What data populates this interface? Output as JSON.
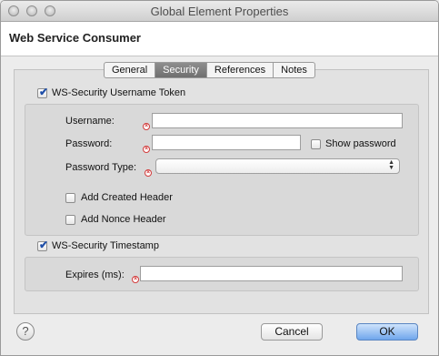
{
  "window": {
    "title": "Global Element Properties"
  },
  "header": {
    "title": "Web Service Consumer"
  },
  "tabs": [
    {
      "label": "General",
      "active": false
    },
    {
      "label": "Security",
      "active": true
    },
    {
      "label": "References",
      "active": false
    },
    {
      "label": "Notes",
      "active": false
    }
  ],
  "security": {
    "username_token": {
      "label": "WS-Security Username Token",
      "checked": true,
      "username_label": "Username:",
      "username_value": "",
      "password_label": "Password:",
      "password_value": "",
      "show_password_label": "Show password",
      "password_type_label": "Password Type:",
      "password_type_value": "",
      "add_created_header_label": "Add Created Header",
      "add_nonce_header_label": "Add Nonce Header"
    },
    "timestamp": {
      "label": "WS-Security Timestamp",
      "checked": true,
      "expires_label": "Expires (ms):",
      "expires_value": ""
    }
  },
  "footer": {
    "help_symbol": "?",
    "cancel_label": "Cancel",
    "ok_label": "OK"
  },
  "colors": {
    "primary_button": "#6fa6ec",
    "error_icon": "#d23b3b",
    "active_tab": "#7a7a7a"
  }
}
